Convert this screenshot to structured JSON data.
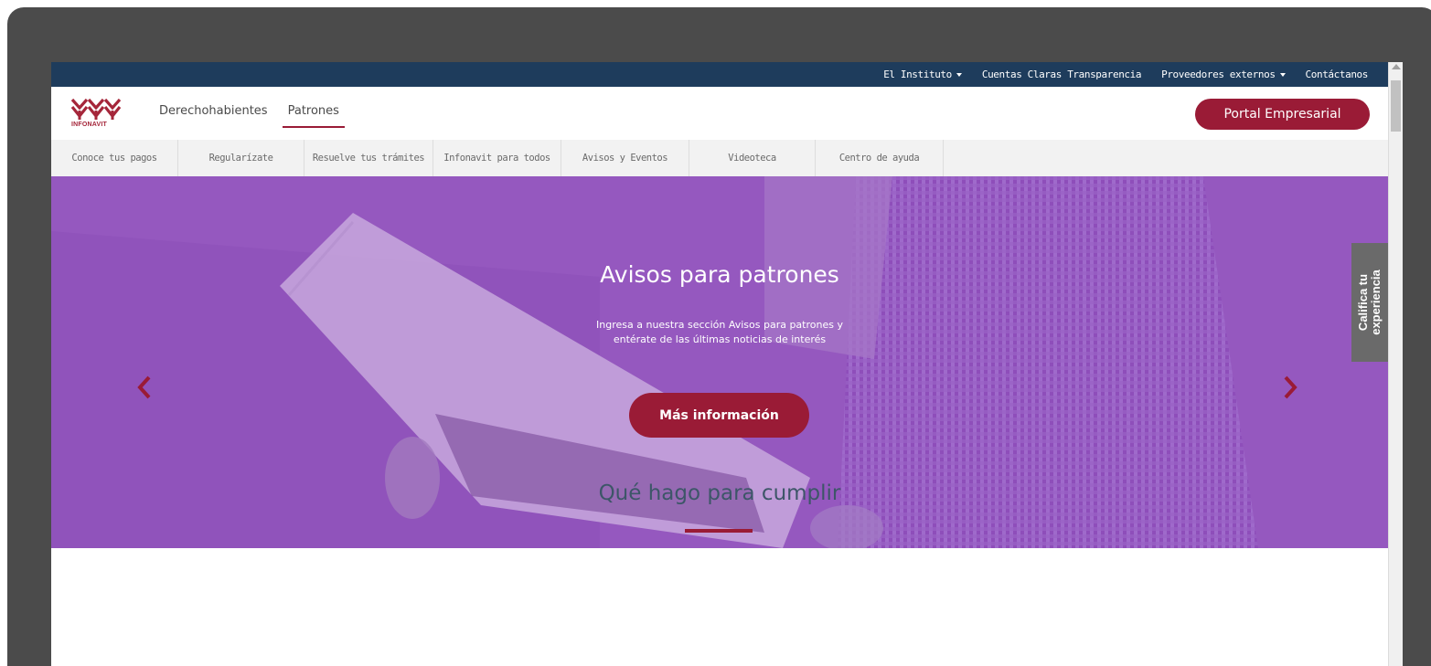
{
  "topbar": {
    "items": [
      {
        "label": "El Instituto",
        "dropdown": true
      },
      {
        "label": "Cuentas Claras Transparencia",
        "dropdown": false
      },
      {
        "label": "Proveedores externos",
        "dropdown": true
      },
      {
        "label": "Contáctanos",
        "dropdown": false
      }
    ]
  },
  "header": {
    "logo_text": "INFONAVIT",
    "nav": [
      {
        "label": "Derechohabientes"
      },
      {
        "label": "Patrones",
        "active": true
      }
    ],
    "portal_button": "Portal Empresarial"
  },
  "subnav": {
    "items": [
      "Conoce tus pagos",
      "Regularízate",
      "Resuelve tus trámites",
      "Infonavit para todos",
      "Avisos y Eventos",
      "Videoteca",
      "Centro de ayuda"
    ]
  },
  "hero": {
    "title": "Avisos para patrones",
    "text_line1": "Ingresa a nuestra sección Avisos para patrones y",
    "text_line2": "entérate de las últimas noticias de interés",
    "button": "Más información",
    "prev_icon": "chevron-left-icon",
    "next_icon": "chevron-right-icon",
    "feedback_line1": "Califica tu",
    "feedback_line2": "experiencia"
  },
  "section": {
    "title": "Qué hago para cumplir"
  },
  "colors": {
    "brand": "#9a1b36",
    "topbar": "#1e3c5c",
    "hero_overlay": "#9b5bc4",
    "feedback_tab": "#6a6a6a"
  }
}
